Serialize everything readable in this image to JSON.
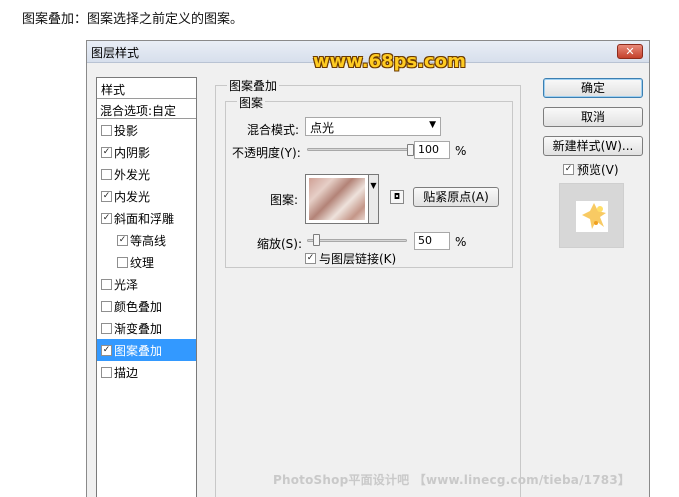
{
  "caption": "图案叠加：图案选择之前定义的图案。",
  "logo_text": "www.68ps.com",
  "dialog": {
    "title": "图层样式",
    "close_glyph": "✕"
  },
  "style_list": {
    "header": "样式",
    "blend_options": "混合选项:自定",
    "items": [
      {
        "label": "投影",
        "checked": false
      },
      {
        "label": "内阴影",
        "checked": true
      },
      {
        "label": "外发光",
        "checked": false
      },
      {
        "label": "内发光",
        "checked": true
      },
      {
        "label": "斜面和浮雕",
        "checked": true
      },
      {
        "label": "等高线",
        "checked": true
      },
      {
        "label": "纹理",
        "checked": false
      },
      {
        "label": "光泽",
        "checked": false
      },
      {
        "label": "颜色叠加",
        "checked": false
      },
      {
        "label": "渐变叠加",
        "checked": false
      },
      {
        "label": "图案叠加",
        "checked": true
      },
      {
        "label": "描边",
        "checked": false
      }
    ]
  },
  "panel": {
    "section_title": "图案叠加",
    "group_title": "图案",
    "blend_mode_label": "混合模式:",
    "blend_mode_value": "点光",
    "opacity_label": "不透明度(Y):",
    "opacity_value": "100",
    "opacity_percent": 100,
    "percent_sign": "%",
    "pattern_label": "图案:",
    "snap_origin_button": "贴紧原点(A)",
    "scale_label": "缩放(S):",
    "scale_value": "50",
    "scale_percent": 50,
    "link_label": "与图层链接(K)",
    "link_checked": true
  },
  "buttons": {
    "ok": "确定",
    "cancel": "取消",
    "new_style": "新建样式(W)...",
    "preview_label": "预览(V)",
    "preview_checked": true
  },
  "watermark": "PhotoShop平面设计吧 【www.linecg.com/tieba/1783】",
  "colors": {
    "selection": "#3399ff",
    "logo": "#ffcc22",
    "close": "#c4412c"
  },
  "icons": {
    "checkbox_on": "✓",
    "dropdown": "▼"
  }
}
